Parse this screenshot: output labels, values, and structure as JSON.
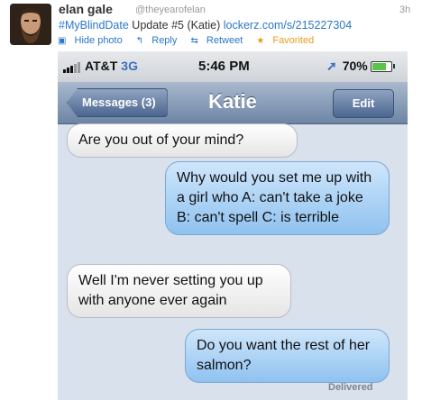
{
  "tweet": {
    "name": "elan gale",
    "handle": "@theyearofelan",
    "time": "3h",
    "hashtag": "#MyBlindDate",
    "text": " Update #5 (Katie) ",
    "link": "lockerz.com/s/215227304",
    "actions": {
      "hide_photo": "Hide photo",
      "reply": "Reply",
      "retweet": "Retweet",
      "favorited": "Favorited"
    }
  },
  "phone": {
    "status": {
      "carrier": "AT&T",
      "network": "3G",
      "time": "5:46 PM",
      "battery": "70%"
    },
    "nav": {
      "back": "Messages (3)",
      "title": "Katie",
      "edit": "Edit"
    },
    "messages": [
      {
        "dir": "in",
        "text": "Are you out of your mind?"
      },
      {
        "dir": "out",
        "text": "Why would you set me up with a girl who A: can't take a joke B: can't spell C: is terrible"
      },
      {
        "dir": "in",
        "text": "Well I'm never setting you up with anyone ever again"
      },
      {
        "dir": "out",
        "text": "Do you want the rest of her salmon?"
      }
    ],
    "delivered": "Delivered"
  },
  "colors": {
    "link": "#2a77c9",
    "favorite": "#e79c1c",
    "outgoing_bubble": "#8fc2f0",
    "navbar": "#6d84a4"
  }
}
